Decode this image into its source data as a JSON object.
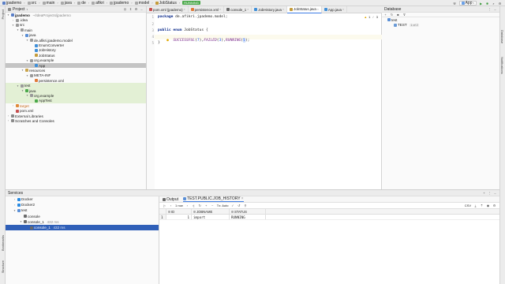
{
  "breadcrumb": [
    "jpademo",
    "src",
    "main",
    "java",
    "de",
    "afikri",
    "jpademo",
    "model",
    "JobStatus"
  ],
  "run": {
    "config_label": "App",
    "status_badge": "RUNNING"
  },
  "project_panel": {
    "title": "Project",
    "tree": [
      {
        "label": "jpademo",
        "suffix": "~/IdeaProjects/jpademo",
        "depth": 0,
        "toggle": "open",
        "icon": "module-icon",
        "bold": true
      },
      {
        "label": ".idea",
        "depth": 1,
        "toggle": "closed",
        "icon": "folder-icon"
      },
      {
        "label": "src",
        "depth": 1,
        "toggle": "open",
        "icon": "folder-icon"
      },
      {
        "label": "main",
        "depth": 2,
        "toggle": "open",
        "icon": "folder-icon"
      },
      {
        "label": "java",
        "depth": 3,
        "toggle": "open",
        "icon": "source-folder-icon"
      },
      {
        "label": "de.afikri.jpademo.model",
        "depth": 4,
        "toggle": "open",
        "icon": "package-icon"
      },
      {
        "label": "EnumConverter",
        "depth": 5,
        "toggle": "",
        "icon": "class-icon"
      },
      {
        "label": "JobHistory",
        "depth": 5,
        "toggle": "",
        "icon": "class-icon"
      },
      {
        "label": "JobStatus",
        "depth": 5,
        "toggle": "",
        "icon": "enum-icon"
      },
      {
        "label": "org.example",
        "depth": 4,
        "toggle": "open",
        "icon": "package-icon"
      },
      {
        "label": "App",
        "depth": 5,
        "toggle": "",
        "icon": "class-icon",
        "selected": true
      },
      {
        "label": "resources",
        "depth": 3,
        "toggle": "open",
        "icon": "resources-folder-icon"
      },
      {
        "label": "META-INF",
        "depth": 4,
        "toggle": "open",
        "icon": "folder-icon"
      },
      {
        "label": "persistence.xml",
        "depth": 5,
        "toggle": "",
        "icon": "xml-file-icon"
      },
      {
        "label": "test",
        "depth": 2,
        "toggle": "open",
        "icon": "folder-icon",
        "green": true
      },
      {
        "label": "java",
        "depth": 3,
        "toggle": "open",
        "icon": "test-folder-icon",
        "green": true
      },
      {
        "label": "org.example",
        "depth": 4,
        "toggle": "open",
        "icon": "package-icon",
        "green": true
      },
      {
        "label": "AppTest",
        "depth": 5,
        "toggle": "",
        "icon": "test-class-icon",
        "green": true
      },
      {
        "label": "target",
        "depth": 1,
        "toggle": "closed",
        "icon": "excluded-folder-icon",
        "orange": true
      },
      {
        "label": "pom.xml",
        "depth": 1,
        "toggle": "",
        "icon": "maven-file-icon"
      },
      {
        "label": "External Libraries",
        "depth": 0,
        "toggle": "closed",
        "icon": "library-icon"
      },
      {
        "label": "Scratches and Consoles",
        "depth": 0,
        "toggle": "closed",
        "icon": "scratch-icon"
      }
    ]
  },
  "editor_tabs": [
    {
      "label": "pom.xml (jpademo)",
      "icon": "maven-file-icon",
      "active": false
    },
    {
      "label": "persistence.xml",
      "icon": "xml-file-icon",
      "active": false
    },
    {
      "label": "console_1",
      "icon": "console-icon",
      "active": false
    },
    {
      "label": "JobHistory.java",
      "icon": "class-icon",
      "active": false
    },
    {
      "label": "JobStatus.java",
      "icon": "enum-icon",
      "active": true
    },
    {
      "label": "App.java",
      "icon": "class-icon",
      "active": false
    }
  ],
  "editor": {
    "line_numbers": [
      "1",
      "2",
      "3",
      "4",
      "5"
    ],
    "line1_kw": "package",
    "line1_rest": " de.afikri.jpademo.model;",
    "line3_kw1": "public",
    "line3_kw2": " enum",
    "line3_rest": " JobStatus {",
    "line4": {
      "a": "SUCCESSFUL",
      "a_num": "7",
      "b": "FAILED",
      "b_num": "3",
      "c": "RUNNING",
      "c_num": "5"
    },
    "line5": "}",
    "inspection_counts": {
      "warnings": "1",
      "weak": "3"
    }
  },
  "database_panel": {
    "title": "Database",
    "items": [
      {
        "label": "test",
        "icon": "database-icon",
        "depth": 0
      },
      {
        "label": "TEST",
        "badge": "1 of 2",
        "icon": "schema-icon",
        "depth": 1
      }
    ]
  },
  "services": {
    "title": "Services",
    "tree": [
      {
        "label": "Docker",
        "depth": 0,
        "icon": "docker-icon",
        "toggle": "closed"
      },
      {
        "label": "Docker2",
        "depth": 0,
        "icon": "docker-icon",
        "toggle": "closed"
      },
      {
        "label": "test",
        "depth": 0,
        "icon": "database-icon",
        "toggle": "open"
      },
      {
        "label": "console",
        "depth": 1,
        "icon": "console-icon",
        "toggle": ""
      },
      {
        "label": "console_1",
        "suffix": "432 ms",
        "depth": 1,
        "icon": "console-icon",
        "toggle": "open"
      },
      {
        "label": "console_1",
        "suffix": "432 ms",
        "depth": 2,
        "icon": "console-icon",
        "toggle": "",
        "selected": true
      }
    ],
    "tabs": [
      {
        "label": "Output"
      },
      {
        "label": "TEST.PUBLIC.JOB_HISTORY"
      }
    ],
    "grid_toolbar": {
      "rows_label": "1 row",
      "tx_label": "Tx: Auto",
      "export_label": "CSV"
    },
    "grid": {
      "columns": [
        "ID",
        "JOBNAME",
        "STATUS"
      ],
      "rows": [
        {
          "num": "1",
          "id": "1",
          "jobname": "import",
          "status": "RUNNING"
        }
      ]
    }
  },
  "strips": {
    "left_top": "Project",
    "left_mid": "Bookmarks",
    "left_bot": "Structure",
    "right_top": "Database",
    "right_mid": "Notifications"
  },
  "colors": {
    "accent": "#3d7ce5",
    "enum_constant": "#7a2a8c",
    "keyword": "#0b2a8a",
    "number": "#1750eb",
    "test_green": "#e3f0d5"
  }
}
